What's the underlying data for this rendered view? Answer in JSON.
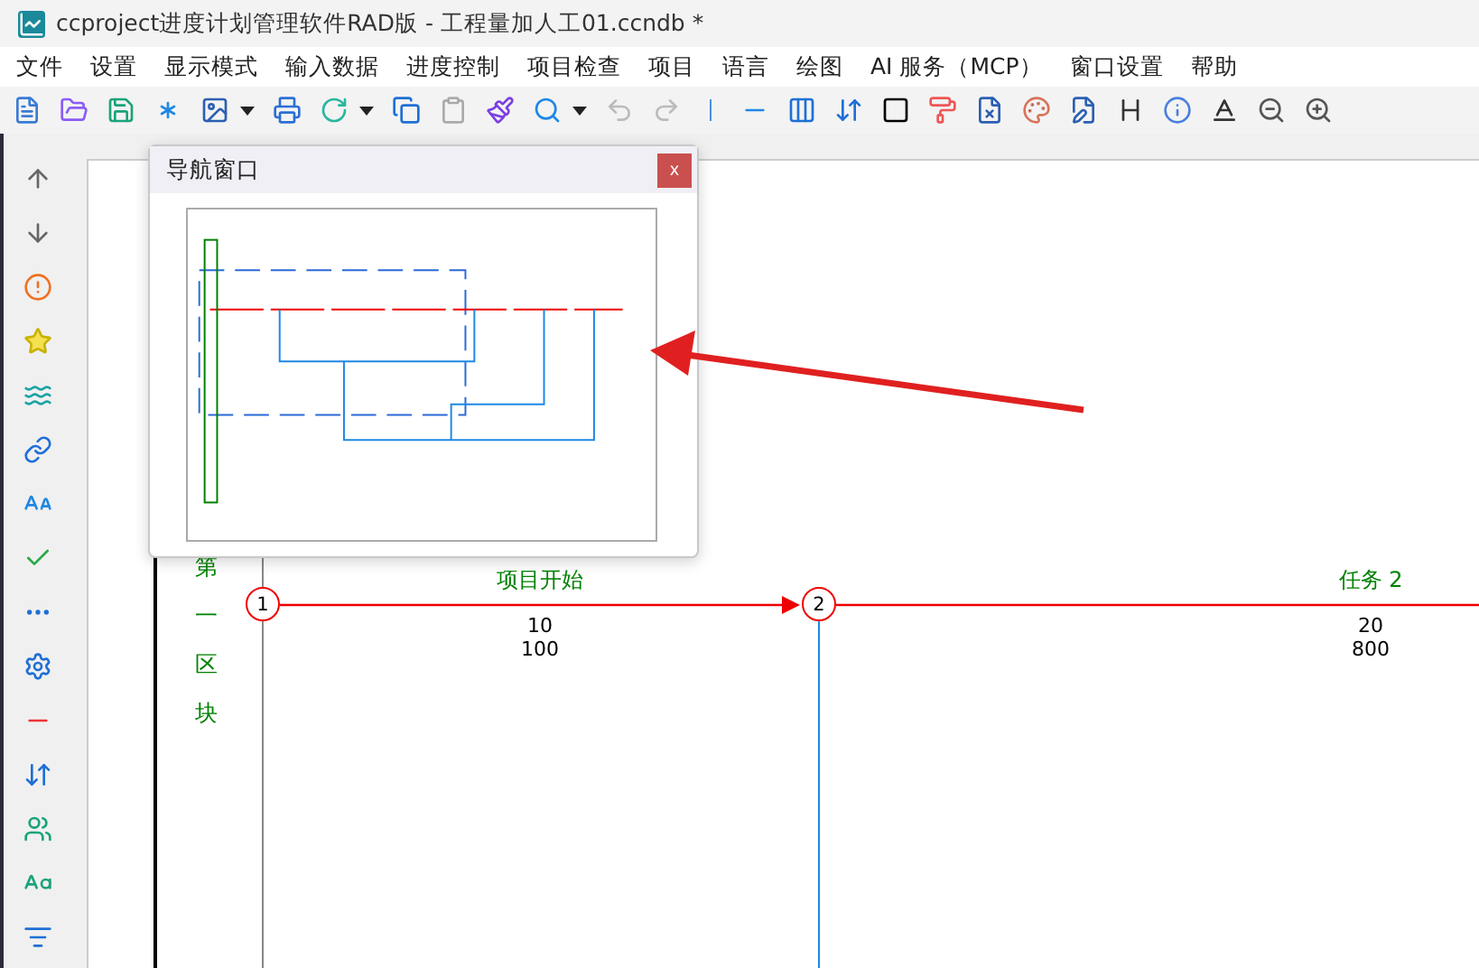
{
  "window": {
    "title": "ccproject进度计划管理软件RAD版 - 工程量加人工01.ccndb *"
  },
  "menu": [
    "文件",
    "设置",
    "显示模式",
    "输入数据",
    "进度控制",
    "项目检查",
    "项目",
    "语言",
    "绘图",
    "AI 服务（MCP）",
    "窗口设置",
    "帮助"
  ],
  "navigator": {
    "title": "导航窗口",
    "close": "x"
  },
  "zone": {
    "label": "第一区块"
  },
  "nodes": [
    {
      "number": "1"
    },
    {
      "number": "2"
    }
  ],
  "activities": [
    {
      "name": "项目开始",
      "duration": "10",
      "quantity": "100",
      "critical": true,
      "arrow": true
    },
    {
      "name": "任务 2",
      "duration": "20",
      "quantity": "800",
      "critical": true,
      "arrow": false
    }
  ]
}
